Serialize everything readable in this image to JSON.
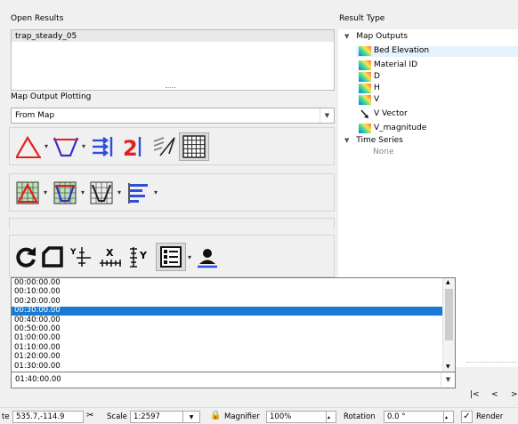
{
  "open_results": {
    "title": "Open Results",
    "items": [
      "trap_steady_05"
    ]
  },
  "map_output_plotting": {
    "title": "Map Output Plotting",
    "source_value": "From Map"
  },
  "result_type": {
    "title": "Result Type",
    "map_outputs_label": "Map Outputs",
    "map_outputs": [
      {
        "label": "Bed Elevation",
        "icon": "gradient-scalar-icon",
        "selected": true
      },
      {
        "label": "Material ID",
        "icon": "gradient-scalar-icon",
        "selected": false
      },
      {
        "label": "D",
        "icon": "gradient-scalar-icon",
        "selected": false
      },
      {
        "label": "H",
        "icon": "gradient-scalar-icon",
        "selected": false
      },
      {
        "label": "V",
        "icon": "gradient-scalar-icon",
        "selected": false
      },
      {
        "label": "V Vector",
        "icon": "vector-arrow-icon",
        "selected": false
      },
      {
        "label": "V_magnitude",
        "icon": "gradient-scalar-icon",
        "selected": false
      }
    ],
    "time_series_label": "Time Series",
    "time_series": [
      {
        "label": "None"
      }
    ]
  },
  "time_list": {
    "items": [
      "00:00:00.00",
      "00:10:00.00",
      "00:20:00.00",
      "00:30:00.00",
      "00:40:00.00",
      "00:50:00.00",
      "01:00:00.00",
      "01:10:00.00",
      "01:20:00.00",
      "01:30:00.00"
    ],
    "selected_index": 3,
    "current_value": "01:40:00.00"
  },
  "player": {
    "first_label": "|<",
    "prev_label": "<",
    "next_label": ">"
  },
  "status_bar": {
    "coordinate_prefix": "te",
    "coordinate": "535.7,-114.9",
    "scale_label": "Scale",
    "scale_value": "1:2597",
    "magnifier_label": "Magnifier",
    "magnifier_value": "100%",
    "rotation_label": "Rotation",
    "rotation_value": "0.0 °",
    "render_label": "Render",
    "render_checked": true
  },
  "colors": {
    "selection": "#1979d3",
    "tree_selection": "#e5f1fb"
  }
}
